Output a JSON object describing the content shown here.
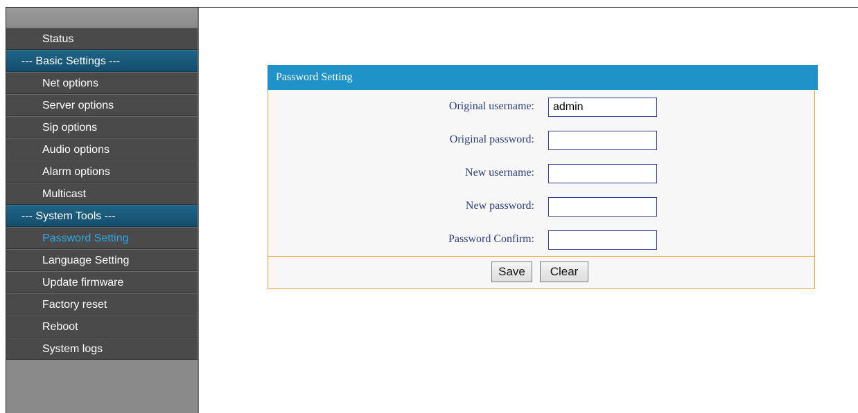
{
  "sidebar": {
    "items": [
      {
        "label": "Status"
      },
      {
        "label": "--- Basic Settings ---"
      },
      {
        "label": "Net options"
      },
      {
        "label": "Server options"
      },
      {
        "label": "Sip options"
      },
      {
        "label": "Audio options"
      },
      {
        "label": "Alarm options"
      },
      {
        "label": "Multicast"
      },
      {
        "label": "--- System Tools ---"
      },
      {
        "label": "Password Setting"
      },
      {
        "label": "Language Setting"
      },
      {
        "label": "Update firmware"
      },
      {
        "label": "Factory reset"
      },
      {
        "label": "Reboot"
      },
      {
        "label": "System logs"
      }
    ],
    "active_label": "Password Setting"
  },
  "panel": {
    "title": "Password Setting",
    "fields": [
      {
        "label": "Original username:",
        "value": "admin"
      },
      {
        "label": "Original password:",
        "value": ""
      },
      {
        "label": "New username:",
        "value": ""
      },
      {
        "label": "New password:",
        "value": ""
      },
      {
        "label": "Password Confirm:",
        "value": ""
      }
    ],
    "save_label": "Save",
    "clear_label": "Clear"
  },
  "colors": {
    "header_blue": "#1f93c7",
    "section_blue": "#1f6487",
    "active_link": "#2fa8e8",
    "panel_border": "#f0a040"
  }
}
